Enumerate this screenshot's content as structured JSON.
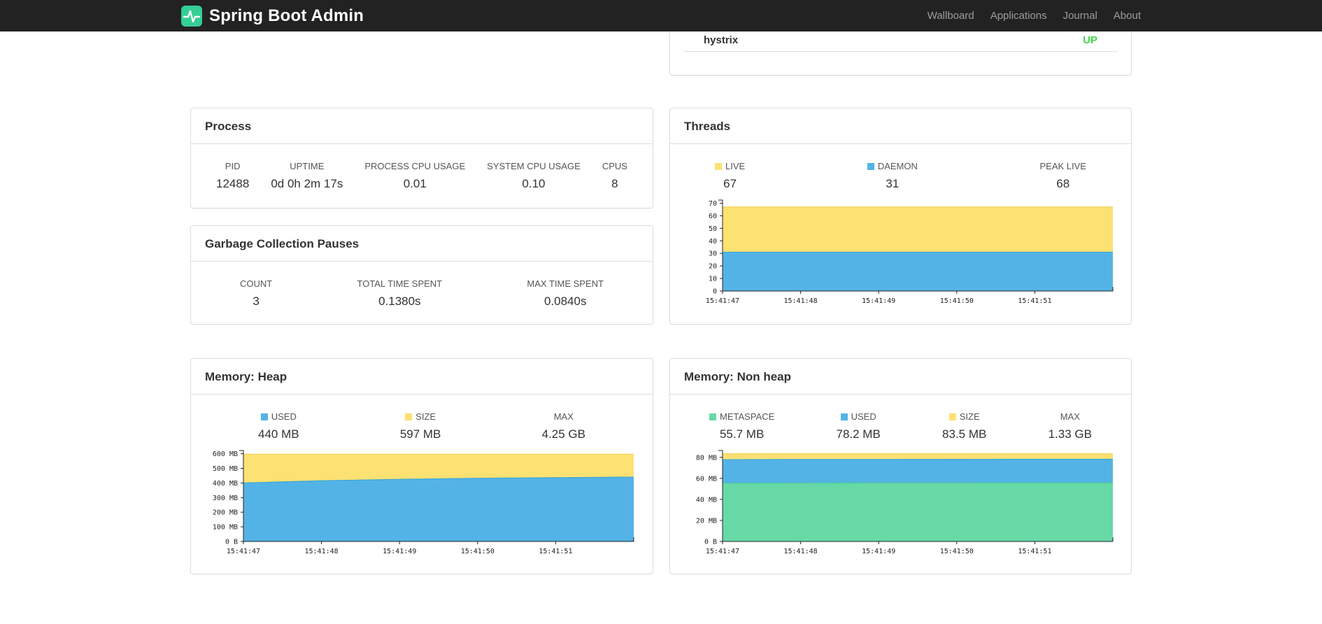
{
  "colors": {
    "navbar_bg": "#222222",
    "brand_green": "#35ce94",
    "nav_link": "#9d9d9d",
    "up_green": "#44d248",
    "blue": "#54b3e6",
    "yellow": "#fce173",
    "green": "#66d9a7",
    "blue_line": "#3aa6db",
    "yellow_line": "#f2d45c",
    "green_line": "#4ecd96"
  },
  "navbar": {
    "brand": "Spring Boot Admin",
    "links": [
      "Wallboard",
      "Applications",
      "Journal",
      "About"
    ]
  },
  "status_card": {
    "application": "hystrix",
    "status": "UP"
  },
  "process": {
    "title": "Process",
    "stats": [
      {
        "label": "PID",
        "value": "12488"
      },
      {
        "label": "UPTIME",
        "value": "0d 0h 2m 17s"
      },
      {
        "label": "PROCESS CPU USAGE",
        "value": "0.01"
      },
      {
        "label": "SYSTEM CPU USAGE",
        "value": "0.10"
      },
      {
        "label": "CPUS",
        "value": "8"
      }
    ]
  },
  "gc": {
    "title": "Garbage Collection Pauses",
    "stats": [
      {
        "label": "COUNT",
        "value": "3"
      },
      {
        "label": "TOTAL TIME SPENT",
        "value": "0.1380s"
      },
      {
        "label": "MAX TIME SPENT",
        "value": "0.0840s"
      }
    ]
  },
  "threads": {
    "title": "Threads",
    "legend": [
      {
        "label": "LIVE",
        "value": "67",
        "swatch": "yellow"
      },
      {
        "label": "DAEMON",
        "value": "31",
        "swatch": "blue"
      },
      {
        "label": "PEAK LIVE",
        "value": "68"
      }
    ]
  },
  "heap": {
    "title": "Memory: Heap",
    "legend": [
      {
        "label": "USED",
        "value": "440 MB",
        "swatch": "blue"
      },
      {
        "label": "SIZE",
        "value": "597 MB",
        "swatch": "yellow"
      },
      {
        "label": "MAX",
        "value": "4.25 GB"
      }
    ]
  },
  "nonheap": {
    "title": "Memory: Non heap",
    "legend": [
      {
        "label": "METASPACE",
        "value": "55.7 MB",
        "swatch": "green"
      },
      {
        "label": "USED",
        "value": "78.2 MB",
        "swatch": "blue"
      },
      {
        "label": "SIZE",
        "value": "83.5 MB",
        "swatch": "yellow"
      },
      {
        "label": "MAX",
        "value": "1.33 GB"
      }
    ]
  },
  "chart_data": [
    {
      "type": "area",
      "title": "Threads",
      "x": [
        "15:41:47",
        "15:41:48",
        "15:41:49",
        "15:41:50",
        "15:41:51"
      ],
      "ylim": [
        0,
        72.5
      ],
      "ytick_values": [
        0,
        10,
        20,
        30,
        40,
        50,
        60,
        70
      ],
      "ytick_labels": [
        "0",
        "10",
        "20",
        "30",
        "40",
        "50",
        "60",
        "70"
      ],
      "series": [
        {
          "name": "LIVE",
          "color_key": "yellow",
          "line_key": "yellow_line",
          "values": [
            67,
            67,
            67,
            67,
            67,
            67
          ]
        },
        {
          "name": "DAEMON",
          "color_key": "blue",
          "line_key": "blue_line",
          "values": [
            31,
            31,
            31,
            31,
            31,
            31
          ]
        }
      ]
    },
    {
      "type": "area",
      "title": "Memory: Heap (MB)",
      "x": [
        "15:41:47",
        "15:41:48",
        "15:41:49",
        "15:41:50",
        "15:41:51"
      ],
      "ylim": [
        0,
        622
      ],
      "ytick_values": [
        0,
        100,
        200,
        300,
        400,
        500,
        600
      ],
      "ytick_labels": [
        "0 B",
        "100 MB",
        "200 MB",
        "300 MB",
        "400 MB",
        "500 MB",
        "600 MB"
      ],
      "series": [
        {
          "name": "SIZE",
          "color_key": "yellow",
          "line_key": "yellow_line",
          "values": [
            597,
            597,
            597,
            597,
            597,
            597
          ]
        },
        {
          "name": "USED",
          "color_key": "blue",
          "line_key": "blue_line",
          "values": [
            400,
            415,
            425,
            432,
            436,
            440
          ]
        }
      ]
    },
    {
      "type": "area",
      "title": "Memory: Non heap (MB)",
      "x": [
        "15:41:47",
        "15:41:48",
        "15:41:49",
        "15:41:50",
        "15:41:51"
      ],
      "ylim": [
        0,
        86.5
      ],
      "ytick_values": [
        0,
        20,
        40,
        60,
        80
      ],
      "ytick_labels": [
        "0 B",
        "20 MB",
        "40 MB",
        "60 MB",
        "80 MB"
      ],
      "series": [
        {
          "name": "SIZE",
          "color_key": "yellow",
          "line_key": "yellow_line",
          "values": [
            83.5,
            83.5,
            83.5,
            83.5,
            83.5,
            83.5
          ]
        },
        {
          "name": "USED",
          "color_key": "blue",
          "line_key": "blue_line",
          "values": [
            77.8,
            78.0,
            78.0,
            78.1,
            78.2,
            78.2
          ]
        },
        {
          "name": "METASPACE",
          "color_key": "green",
          "line_key": "green_line",
          "values": [
            55.4,
            55.5,
            55.6,
            55.6,
            55.7,
            55.7
          ]
        }
      ]
    }
  ]
}
